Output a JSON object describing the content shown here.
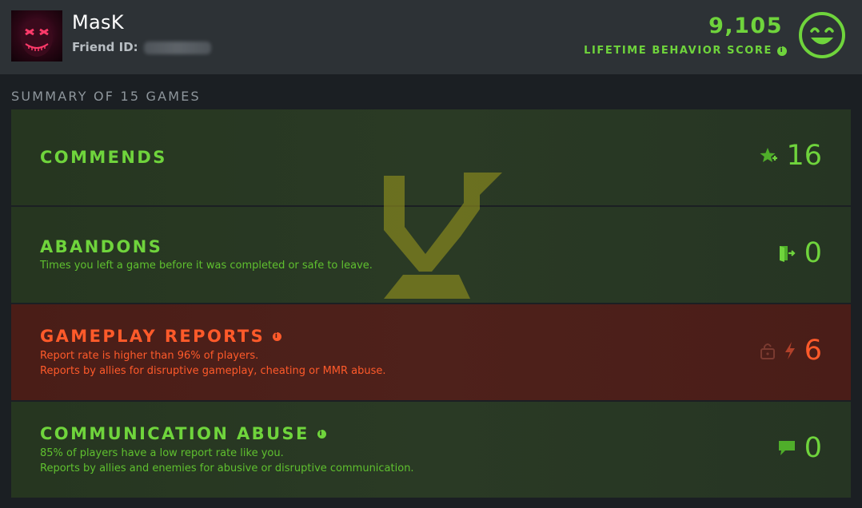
{
  "header": {
    "username": "MasK",
    "friend_id_label": "Friend ID:",
    "score_value": "9,105",
    "score_label": "LIFETIME BEHAVIOR SCORE"
  },
  "summary": {
    "title": "SUMMARY OF 15 GAMES"
  },
  "cards": [
    {
      "title": "COMMENDS",
      "subtitles": [],
      "value": "16",
      "icon": "star-plus-icon",
      "status": "good"
    },
    {
      "title": "ABANDONS",
      "subtitles": [
        "Times you left a game before it was completed or safe to leave."
      ],
      "value": "0",
      "icon": "exit-door-icon",
      "status": "good"
    },
    {
      "title": "GAMEPLAY REPORTS",
      "subtitles": [
        "Report rate is higher than 96% of players.",
        "Reports by allies for disruptive gameplay, cheating or MMR abuse."
      ],
      "value": "6",
      "icon": "lightning-icon",
      "status": "bad"
    },
    {
      "title": "COMMUNICATION ABUSE",
      "subtitles": [
        "85% of players have a low report rate like you.",
        "Reports by allies and enemies for abusive or disruptive communication."
      ],
      "value": "0",
      "icon": "chat-bubble-icon",
      "status": "good"
    }
  ],
  "colors": {
    "good": "#6fd43c",
    "bad": "#ff5a2a",
    "header_bg": "#2d3236"
  }
}
